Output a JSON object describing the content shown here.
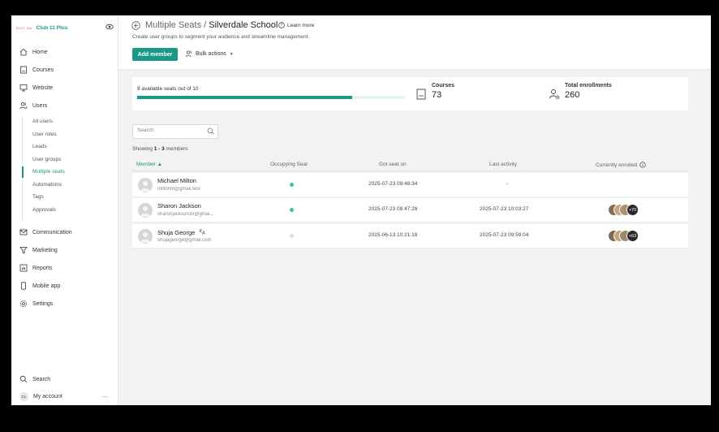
{
  "brand": {
    "logo_text": "EIUT Idu",
    "name": "Club 11 Plus"
  },
  "nav": {
    "home": "Home",
    "courses": "Courses",
    "website": "Website",
    "users": "Users",
    "users_sub": [
      "All users",
      "User roles",
      "Leads",
      "User groups",
      "Multiple seats",
      "Automations",
      "Tags",
      "Approvals"
    ],
    "communication": "Communication",
    "marketing": "Marketing",
    "reports": "Reports",
    "mobile_app": "Mobile app",
    "settings": "Settings",
    "search": "Search",
    "account_initials": "CL",
    "account": "My account",
    "account_more": "…"
  },
  "header": {
    "title_prefix": "Multiple Seats / ",
    "title_school": "Silverdale School",
    "learn_more": "Learn more",
    "subtitle": "Create user groups to segment your audience and streamline management.",
    "add_member": "Add member",
    "bulk_actions": "Bulk actions"
  },
  "stats": {
    "seats_label": "8 available seats out of 10",
    "seats_used_fraction": 0.8,
    "courses_label": "Courses",
    "courses_value": "73",
    "enrollments_label": "Total enrollments",
    "enrollments_value": "260"
  },
  "search": {
    "placeholder": "Search"
  },
  "showing": {
    "prefix": "Showing ",
    "range": "1 - 3",
    "suffix": " members"
  },
  "table": {
    "headers": {
      "member": "Member ▲",
      "occupying": "Occupying Seat",
      "got_seat": "Got seat on",
      "last_activity": "Last activity",
      "enrolled": "Currently enrolled"
    },
    "rows": [
      {
        "name": "Michael Milton",
        "email": "miltonm@gmail.test",
        "occupying": true,
        "got_seat": "2025-07-23 09:48:34",
        "last_activity": "-",
        "enrolled_more": ""
      },
      {
        "name": "Sharon Jackson",
        "email": "sharonjackson33@gmai...",
        "occupying": true,
        "got_seat": "2025-07-23 09:47:28",
        "last_activity": "2025-07-23 10:03:27",
        "enrolled_more": "+70"
      },
      {
        "name": "Shuja George",
        "email": "shujageorge@gmail.com",
        "occupying": false,
        "got_seat": "2025-06-13 10:21:18",
        "last_activity": "2025-07-23 09:59:04",
        "enrolled_more": "+63"
      }
    ]
  },
  "colors": {
    "accent": "#1a9a86",
    "seat_on": "#3fbfa9",
    "seat_off": "#e0e0e0"
  }
}
